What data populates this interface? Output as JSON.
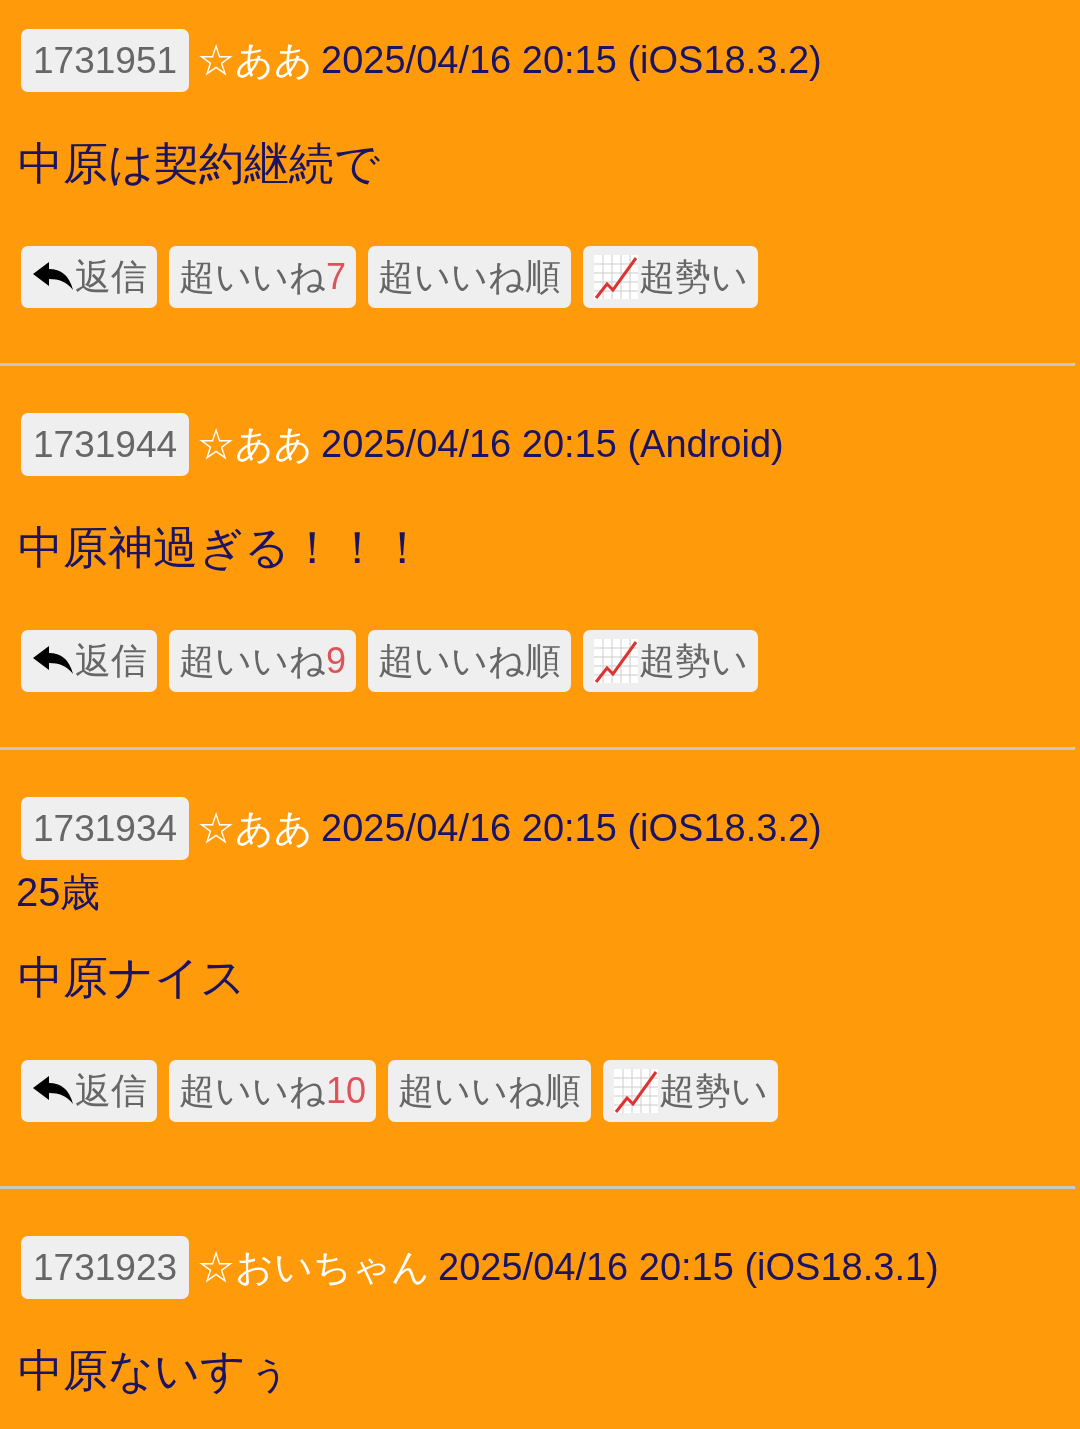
{
  "posts": [
    {
      "number": "1731951",
      "name": "☆ああ",
      "meta": "2025/04/16 20:15 (iOS18.3.2)",
      "body": "中原は契約継続で",
      "actions": {
        "reply": "返信",
        "like": "超いいね",
        "like_count": "7",
        "sort": "超いいね順",
        "trend": "超勢い"
      }
    },
    {
      "number": "1731944",
      "name": "☆ああ",
      "meta": "2025/04/16 20:15 (Android)",
      "body": "中原神過ぎる！！！",
      "actions": {
        "reply": "返信",
        "like": "超いいね",
        "like_count": "9",
        "sort": "超いいね順",
        "trend": "超勢い"
      }
    },
    {
      "number": "1731934",
      "name": "☆ああ",
      "meta": "2025/04/16 20:15 (iOS18.3.2)",
      "note": "25歳",
      "body": "中原ナイス",
      "actions": {
        "reply": "返信",
        "like": "超いいね",
        "like_count": "10",
        "sort": "超いいね順",
        "trend": "超勢い"
      }
    },
    {
      "number": "1731923",
      "name": "☆おいちゃん",
      "meta": "2025/04/16 20:15 (iOS18.3.1)",
      "body": "中原ないすぅ"
    }
  ]
}
